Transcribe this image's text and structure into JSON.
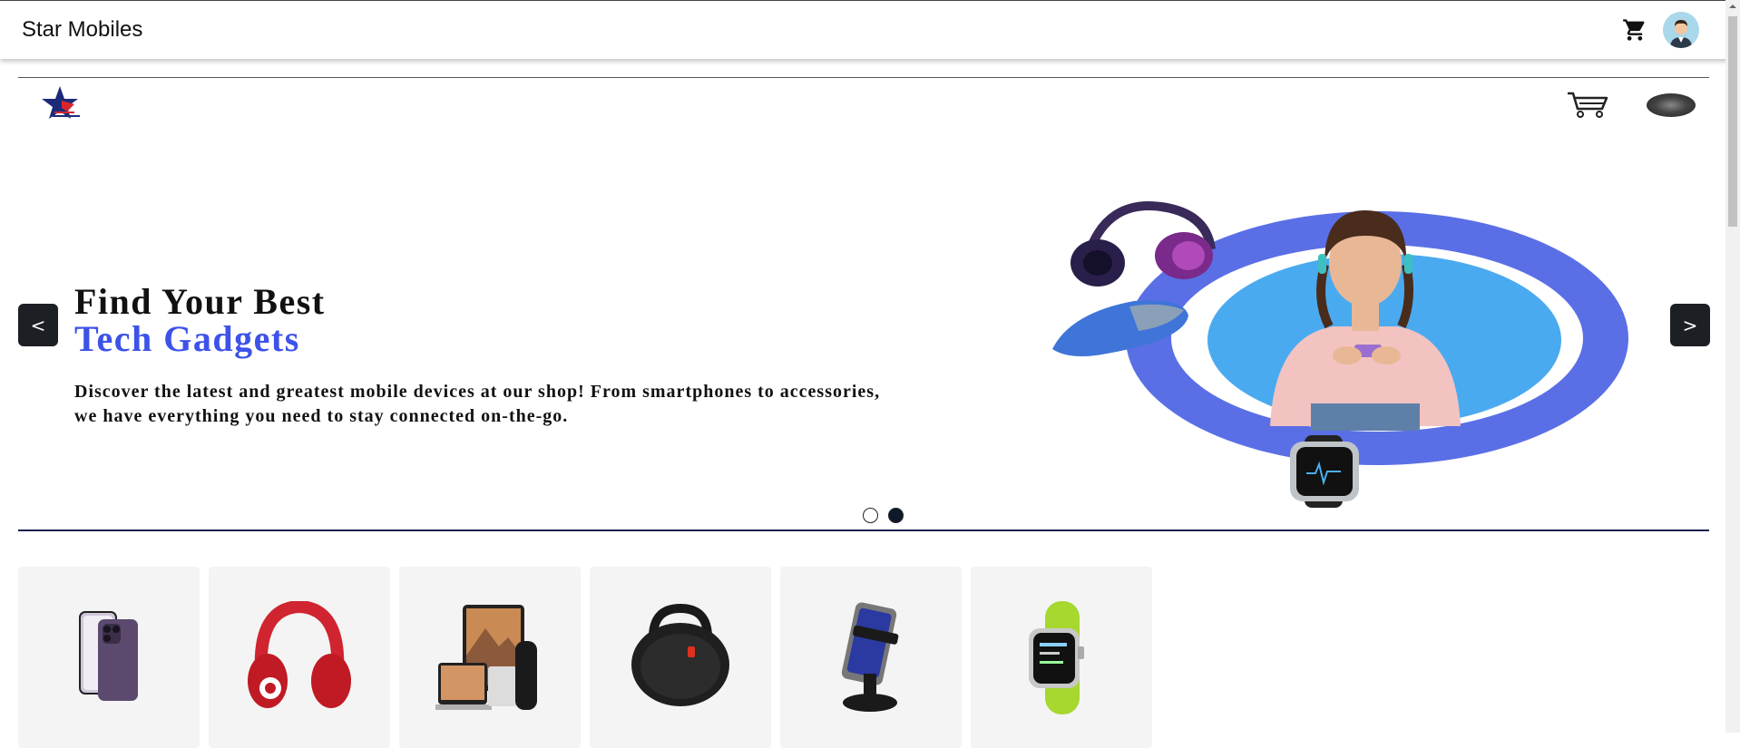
{
  "app": {
    "title": "Star Mobiles"
  },
  "header": {
    "cart_icon": "shopping-cart-icon",
    "avatar_icon": "user-avatar-icon"
  },
  "banner": {
    "logo_icon": "star-mobiles-logo",
    "cart_icon": "cart-outline-icon",
    "avatar_icon": "user-photo-avatar"
  },
  "hero": {
    "title_line1": "Find Your Best",
    "title_line2": "Tech Gadgets",
    "description": "Discover the latest and greatest mobile devices at our shop! From smartphones to accessories, we have everything you need to stay connected on-the-go.",
    "prev_label": "<",
    "next_label": ">",
    "slide_count": 2,
    "active_slide": 2
  },
  "products": [
    {
      "icon": "iphone-icon"
    },
    {
      "icon": "headphones-icon"
    },
    {
      "icon": "apple-devices-icon"
    },
    {
      "icon": "speaker-icon"
    },
    {
      "icon": "phone-mount-icon"
    },
    {
      "icon": "smartwatch-icon"
    }
  ],
  "colors": {
    "accent_blue": "#3d52e8",
    "ring_blue": "#5a6fe6",
    "inner_blue": "#4aaaf0",
    "nav_button": "#1c1f24"
  }
}
